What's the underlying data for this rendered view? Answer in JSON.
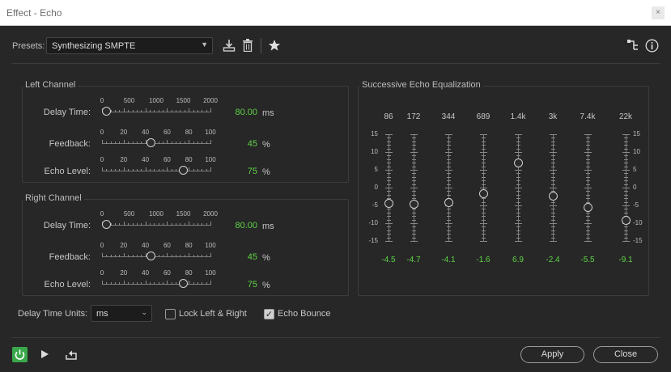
{
  "window": {
    "title": "Effect - Echo",
    "close_glyph": "×"
  },
  "presets": {
    "label": "Presets:",
    "value": "Synthesizing SMPTE"
  },
  "left_channel": {
    "title": "Left Channel",
    "delay_time": {
      "label": "Delay Time:",
      "value": "80.00",
      "unit": "ms",
      "ticks": [
        "0",
        "500",
        "1000",
        "1500",
        "2000"
      ],
      "level": 0.04
    },
    "feedback": {
      "label": "Feedback:",
      "value": "45",
      "unit": "%",
      "ticks": [
        "0",
        "20",
        "40",
        "60",
        "80",
        "100"
      ],
      "level": 0.45
    },
    "echo_level": {
      "label": "Echo Level:",
      "value": "75",
      "unit": "%",
      "ticks": [
        "0",
        "20",
        "40",
        "60",
        "80",
        "100"
      ],
      "level": 0.75
    }
  },
  "right_channel": {
    "title": "Right Channel",
    "delay_time": {
      "label": "Delay Time:",
      "value": "80.00",
      "unit": "ms",
      "ticks": [
        "0",
        "500",
        "1000",
        "1500",
        "2000"
      ],
      "level": 0.04
    },
    "feedback": {
      "label": "Feedback:",
      "value": "45",
      "unit": "%",
      "ticks": [
        "0",
        "20",
        "40",
        "60",
        "80",
        "100"
      ],
      "level": 0.45
    },
    "echo_level": {
      "label": "Echo Level:",
      "value": "75",
      "unit": "%",
      "ticks": [
        "0",
        "20",
        "40",
        "60",
        "80",
        "100"
      ],
      "level": 0.75
    }
  },
  "equalizer": {
    "title": "Successive Echo Equalization",
    "scale": [
      "15",
      "10",
      "5",
      "0",
      "-5",
      "-10",
      "-15"
    ],
    "bands": [
      {
        "freq": "86",
        "value": "-4.5",
        "db": -4.5
      },
      {
        "freq": "172",
        "value": "-4.7",
        "db": -4.7
      },
      {
        "freq": "344",
        "value": "-4.1",
        "db": -4.1
      },
      {
        "freq": "689",
        "value": "-1.6",
        "db": -1.6
      },
      {
        "freq": "1.4k",
        "value": "6.9",
        "db": 6.9
      },
      {
        "freq": "3k",
        "value": "-2.4",
        "db": -2.4
      },
      {
        "freq": "7.4k",
        "value": "-5.5",
        "db": -5.5
      },
      {
        "freq": "22k",
        "value": "-9.1",
        "db": -9.1
      }
    ]
  },
  "delay_units": {
    "label": "Delay Time Units:",
    "value": "ms"
  },
  "lock": {
    "label": "Lock Left & Right",
    "checked": false
  },
  "bounce": {
    "label": "Echo Bounce",
    "checked": true,
    "mark": "✓"
  },
  "footer": {
    "apply": "Apply",
    "close": "Close"
  },
  "colors": {
    "accent_green": "#5fd347",
    "power_green": "#3aa84a"
  }
}
